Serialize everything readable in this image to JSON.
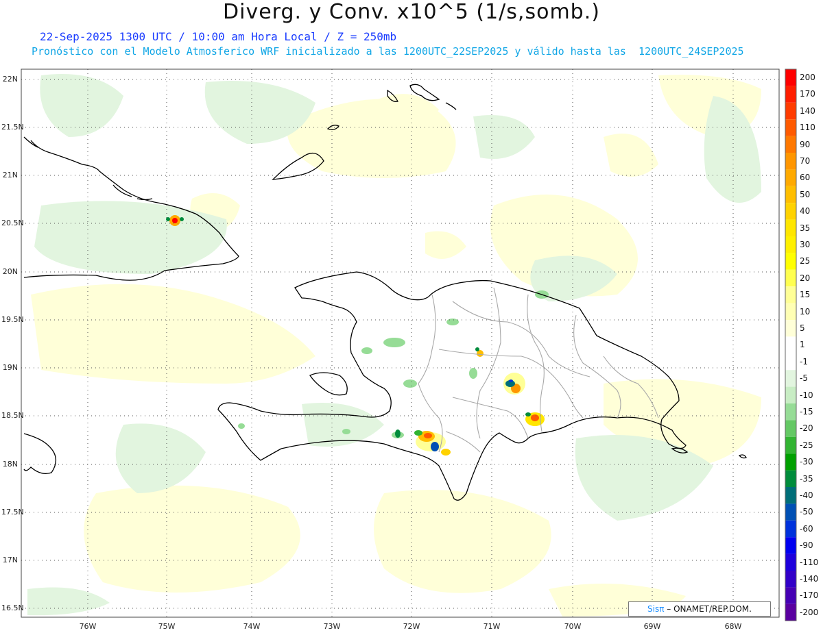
{
  "header": {
    "title": "Diverg. y Conv. x10^5 (1/s,somb.)",
    "subtitle": "22-Sep-2025 1300 UTC / 10:00 am Hora Local / Z = 250mb",
    "description": "Pronóstico con el Modelo Atmosferico WRF inicializado a las 1200UTC_22SEP2025 y válido hasta las  1200UTC_24SEP2025"
  },
  "axes": {
    "lat_labels": [
      "22N",
      "21.5N",
      "21N",
      "20.5N",
      "20N",
      "19.5N",
      "19N",
      "18.5N",
      "18N",
      "17.5N",
      "17N",
      "16.5N"
    ],
    "lon_labels": [
      "76W",
      "75W",
      "74W",
      "73W",
      "72W",
      "71W",
      "70W",
      "69W",
      "68W"
    ]
  },
  "colorbar": {
    "levels": [
      "200",
      "170",
      "140",
      "110",
      "90",
      "70",
      "60",
      "50",
      "40",
      "35",
      "30",
      "25",
      "20",
      "15",
      "10",
      "5",
      "1",
      "-1",
      "-5",
      "-10",
      "-15",
      "-20",
      "-25",
      "-30",
      "-35",
      "-40",
      "-50",
      "-60",
      "-90",
      "-110",
      "-140",
      "-170",
      "-200"
    ],
    "colors": [
      "#ff0000",
      "#ff1e00",
      "#ff3c00",
      "#ff5a00",
      "#ff7800",
      "#ff9600",
      "#ffaa00",
      "#ffbe00",
      "#ffd200",
      "#ffe600",
      "#fff000",
      "#ffff00",
      "#ffff50",
      "#ffff96",
      "#ffffb4",
      "#ffffd8",
      "#ffffff",
      "#ffffff",
      "#e2f5df",
      "#c8edc4",
      "#96dc96",
      "#64c864",
      "#32b432",
      "#00a000",
      "#008c3c",
      "#006e78",
      "#0050b4",
      "#0032dc",
      "#0000f0",
      "#1e00dc",
      "#3200c8",
      "#4600b4",
      "#5a00a0"
    ]
  },
  "credit": {
    "logo": "Sisπ",
    "text": "– ONAMET/REP.DOM."
  }
}
